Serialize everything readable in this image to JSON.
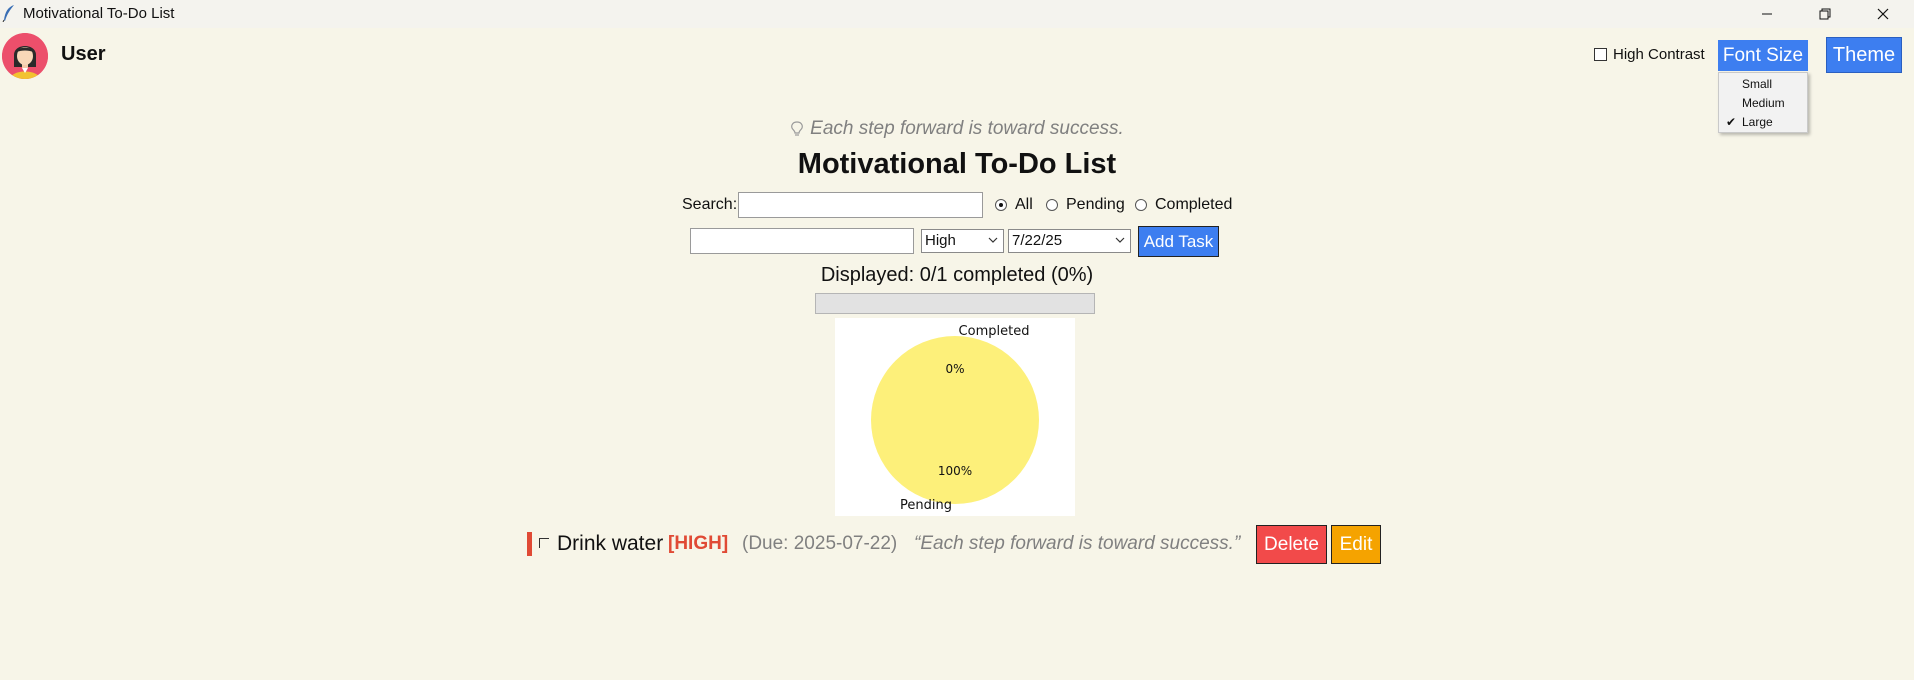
{
  "window": {
    "title": "Motivational To-Do List"
  },
  "header": {
    "username": "User",
    "high_contrast_label": "High Contrast",
    "high_contrast_checked": false,
    "font_size_button": "Font Size",
    "theme_button": "Theme"
  },
  "font_size_menu": {
    "items": [
      {
        "label": "Small",
        "checked": false
      },
      {
        "label": "Medium",
        "checked": false
      },
      {
        "label": "Large",
        "checked": true
      }
    ]
  },
  "main": {
    "quote": "Each step forward is toward success.",
    "title": "Motivational To-Do List",
    "search_label": "Search:",
    "search_value": "",
    "filters": [
      {
        "label": "All",
        "selected": true
      },
      {
        "label": "Pending",
        "selected": false
      },
      {
        "label": "Completed",
        "selected": false
      }
    ],
    "new_task_value": "",
    "priority_select": "High",
    "date_select": "7/22/25",
    "add_button": "Add Task",
    "displayed_text": "Displayed: 0/1 completed (0%)",
    "progress_fraction": 0
  },
  "chart_data": {
    "type": "pie",
    "labels": [
      "Completed",
      "Pending"
    ],
    "values": [
      0,
      100
    ],
    "value_labels": [
      "0%",
      "100%"
    ],
    "colors": [
      "#7ccf7c",
      "#fdf07a"
    ]
  },
  "tasks": [
    {
      "name": "Drink water",
      "priority": "[HIGH]",
      "due": "(Due: 2025-07-22)",
      "quote": "“Each step forward is toward success.”",
      "completed": false,
      "delete_label": "Delete",
      "edit_label": "Edit"
    }
  ],
  "colors": {
    "background": "#f7f5e8",
    "accent_blue": "#3d7ef0",
    "delete_red": "#f24a4a",
    "edit_orange": "#f5a300",
    "priority_high": "#e04a35"
  }
}
